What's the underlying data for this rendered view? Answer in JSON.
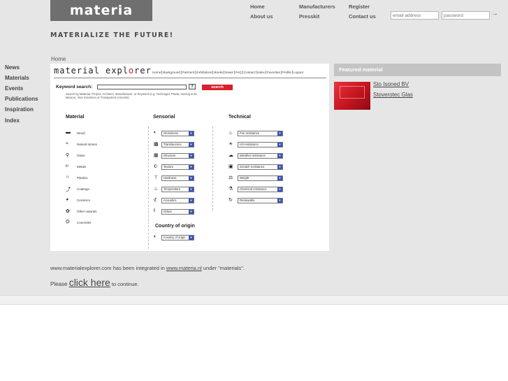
{
  "logo": {
    "text": "materia",
    "tagline": "MATERIALIZE THE FUTURE!"
  },
  "topnav": {
    "home": "Home",
    "about": "About us",
    "manufacturers": "Manufacturers",
    "presskit": "Presskit",
    "register": "Register",
    "contact": "Contact us"
  },
  "login": {
    "email_placeholder": "email address",
    "password_placeholder": "password",
    "submit_icon": "arrow-right-icon"
  },
  "leftnav": [
    "News",
    "Materials",
    "Events",
    "Publications",
    "Inspiration",
    "Index"
  ],
  "breadcrumb": "Home",
  "explorer": {
    "logo_pre": "material expl",
    "logo_o": "o",
    "logo_post": "rer",
    "menu": [
      "Home",
      "Background",
      "Partners",
      "Exhibitions",
      "Books",
      "News",
      "FAQ",
      "Contact",
      "Index",
      "Favorites",
      "Profile",
      "Logout"
    ],
    "keyword_label": "Keyword search:",
    "help": "?",
    "search_button": "search",
    "hint": "Search by Material, Project, Architect, Manufacturer, or Keyword (e.g. Technogel, Prada, Herzog & de Meuron, Viva Ceramica or Transparent concrete)",
    "col_material": "Material",
    "col_sensorial": "Sensorial",
    "col_technical": "Technical",
    "materials": [
      "Wood",
      "Natural stones",
      "Glass",
      "Metals",
      "Plastics",
      "Coatings",
      "Ceramics",
      "Other naturals",
      "Concretes"
    ],
    "sensorial": [
      "Glossiness",
      "Translucence",
      "Structure",
      "Texture",
      "Hardness",
      "Temperature",
      "Acoustics",
      "Odour"
    ],
    "technical": [
      "Fire resistance",
      "UV-resistance",
      "Weather resistance",
      "Scratch resistance",
      "Weight",
      "Chemical resistance",
      "Renewable"
    ],
    "origin_title": "Country of origin",
    "origin_select": "Country of origin"
  },
  "featured": {
    "title": "Featured material",
    "links": [
      "Sto Isoned BV",
      "Stoverotec Glas"
    ]
  },
  "note": {
    "pre": "www.materialexplorer.com has been integrated in ",
    "link": "www.materia.nl",
    "post": " under \"materials\"."
  },
  "cta": {
    "pre": "Please ",
    "link": "click here",
    "post": " to continue."
  }
}
